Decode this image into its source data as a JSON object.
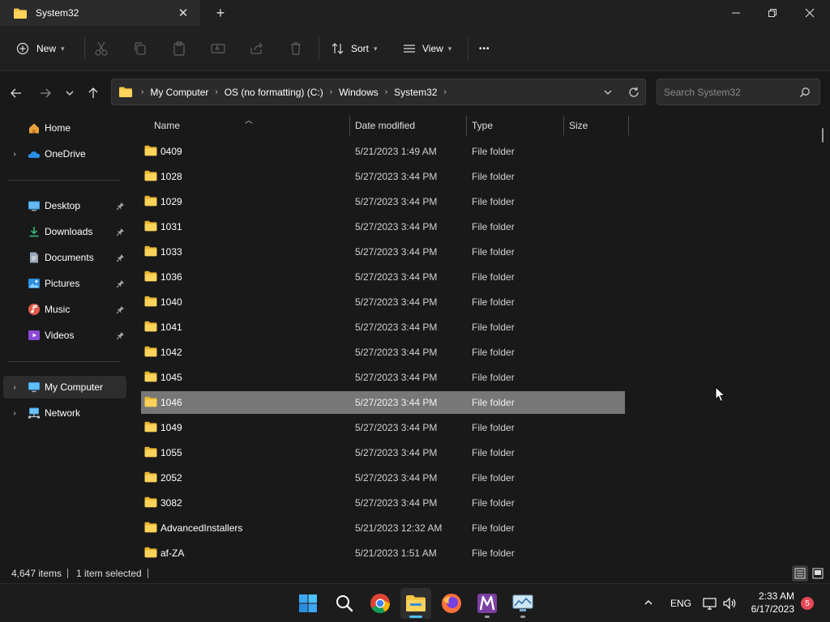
{
  "window": {
    "tab_title": "System32",
    "tab_close": "✕",
    "new_tab": "+",
    "minimize": "─",
    "maximize": "❐",
    "close": "✕"
  },
  "toolbar": {
    "new_label": "New",
    "sort_label": "Sort",
    "view_label": "View",
    "more_label": "•••",
    "icons": [
      "cut-icon",
      "copy-icon",
      "paste-icon",
      "rename-icon",
      "share-icon",
      "delete-icon"
    ]
  },
  "address": {
    "crumbs": [
      "My Computer",
      "OS (no formatting) (C:)",
      "Windows",
      "System32"
    ],
    "separator": "›",
    "search_placeholder": "Search System32"
  },
  "sidebar": {
    "items": [
      {
        "label": "Home",
        "icon": "home-icon",
        "expander": "",
        "pinned": false
      },
      {
        "label": "OneDrive",
        "icon": "onedrive-icon",
        "expander": "›",
        "pinned": false
      },
      {
        "label": "Desktop",
        "icon": "desktop-icon",
        "expander": "",
        "pinned": true
      },
      {
        "label": "Downloads",
        "icon": "downloads-icon",
        "expander": "",
        "pinned": true
      },
      {
        "label": "Documents",
        "icon": "documents-icon",
        "expander": "",
        "pinned": true
      },
      {
        "label": "Pictures",
        "icon": "pictures-icon",
        "expander": "",
        "pinned": true
      },
      {
        "label": "Music",
        "icon": "music-icon",
        "expander": "",
        "pinned": true
      },
      {
        "label": "Videos",
        "icon": "videos-icon",
        "expander": "",
        "pinned": true
      },
      {
        "label": "My Computer",
        "icon": "computer-icon",
        "expander": "›",
        "pinned": false,
        "selected": true
      },
      {
        "label": "Network",
        "icon": "network-icon",
        "expander": "›",
        "pinned": false
      }
    ]
  },
  "columns": {
    "name": "Name",
    "date": "Date modified",
    "type": "Type",
    "size": "Size"
  },
  "files": [
    {
      "name": "0409",
      "date": "5/21/2023 1:49 AM",
      "type": "File folder"
    },
    {
      "name": "1028",
      "date": "5/27/2023 3:44 PM",
      "type": "File folder"
    },
    {
      "name": "1029",
      "date": "5/27/2023 3:44 PM",
      "type": "File folder"
    },
    {
      "name": "1031",
      "date": "5/27/2023 3:44 PM",
      "type": "File folder"
    },
    {
      "name": "1033",
      "date": "5/27/2023 3:44 PM",
      "type": "File folder"
    },
    {
      "name": "1036",
      "date": "5/27/2023 3:44 PM",
      "type": "File folder"
    },
    {
      "name": "1040",
      "date": "5/27/2023 3:44 PM",
      "type": "File folder"
    },
    {
      "name": "1041",
      "date": "5/27/2023 3:44 PM",
      "type": "File folder"
    },
    {
      "name": "1042",
      "date": "5/27/2023 3:44 PM",
      "type": "File folder"
    },
    {
      "name": "1045",
      "date": "5/27/2023 3:44 PM",
      "type": "File folder"
    },
    {
      "name": "1046",
      "date": "5/27/2023 3:44 PM",
      "type": "File folder",
      "selected": true
    },
    {
      "name": "1049",
      "date": "5/27/2023 3:44 PM",
      "type": "File folder"
    },
    {
      "name": "1055",
      "date": "5/27/2023 3:44 PM",
      "type": "File folder"
    },
    {
      "name": "2052",
      "date": "5/27/2023 3:44 PM",
      "type": "File folder"
    },
    {
      "name": "3082",
      "date": "5/27/2023 3:44 PM",
      "type": "File folder"
    },
    {
      "name": "AdvancedInstallers",
      "date": "5/21/2023 12:32 AM",
      "type": "File folder"
    },
    {
      "name": "af-ZA",
      "date": "5/21/2023 1:51 AM",
      "type": "File folder"
    }
  ],
  "status": {
    "items_count": "4,647 items",
    "selected": "1 item selected"
  },
  "taskbar": {
    "language": "ENG",
    "time": "2:33 AM",
    "date": "6/17/2023",
    "notification_count": "5",
    "apps": [
      "windows-start-icon",
      "search-icon",
      "chrome-icon",
      "file-explorer-icon",
      "firefox-icon",
      "m-app-icon",
      "monitor-app-icon"
    ]
  },
  "colors": {
    "folder": "#f4c544",
    "accent": "#4cc2ff",
    "selection": "#777777"
  }
}
